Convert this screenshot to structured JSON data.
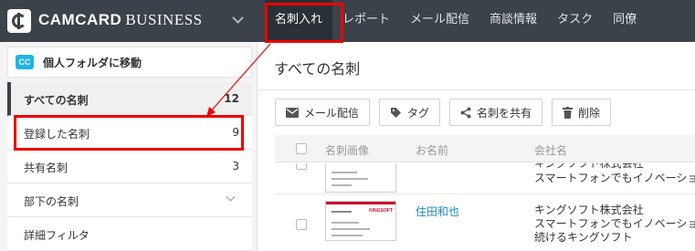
{
  "brand": {
    "name_bold": "CAMCARD",
    "name_light": "BUSINESS"
  },
  "nav": {
    "items": [
      {
        "label": "名刺入れ",
        "active": true
      },
      {
        "label": "レポート"
      },
      {
        "label": "メール配信"
      },
      {
        "label": "商談情報"
      },
      {
        "label": "タスク"
      },
      {
        "label": "同僚"
      }
    ]
  },
  "sidebar": {
    "move_badge": "CC",
    "move_label": "個人フォルダに移動",
    "items": [
      {
        "label": "すべての名刺",
        "count": "12"
      },
      {
        "label": "登録した名刺",
        "count": "9"
      },
      {
        "label": "共有名刺",
        "count": "3"
      },
      {
        "label": "部下の名刺",
        "icon": "chevron-down-icon"
      },
      {
        "label": "詳細フィルタ"
      }
    ]
  },
  "main": {
    "title": "すべての名刺",
    "toolbar": {
      "mail": "メール配信",
      "tag": "タグ",
      "share": "名刺を共有",
      "delete": "削除"
    },
    "table": {
      "headers": {
        "image": "名刺画像",
        "name": "お名前",
        "company": "会社名"
      },
      "rows": [
        {
          "name": "",
          "company_lines": [
            "キングソフト株式会社",
            "スマートフォンでもイノベーションを"
          ]
        },
        {
          "name": "住田和也",
          "company_lines": [
            "キングソフト株式会社",
            "スマートフォンでもイノベーションを",
            "続けるキングソフト"
          ],
          "card_logo": "KINGSOFT"
        }
      ]
    }
  },
  "colors": {
    "topbar": "#3b4249",
    "accent": "#1cb6e4",
    "highlight": "#e00000",
    "link": "#1a8cc0"
  }
}
